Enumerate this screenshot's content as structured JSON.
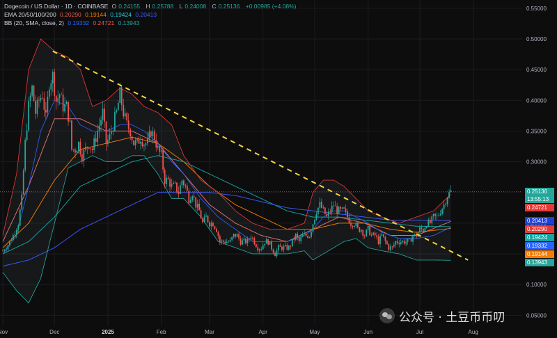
{
  "legend": {
    "line1": {
      "title": "Dogecoin / US Dollar · 1D · COINBASE",
      "o_label": "O",
      "o": "0.24155",
      "h_label": "H",
      "h": "0.25788",
      "l_label": "L",
      "l": "0.24008",
      "c_label": "C",
      "c": "0.25136",
      "change": "+0.00985 (+4.08%)"
    },
    "line2": {
      "name": "EMA 20/50/100/200",
      "v1": "0.20290",
      "v2": "0.19144",
      "v3": "0.19424",
      "v4": "0.20413"
    },
    "line3": {
      "name": "BB (20, SMA, close, 2)",
      "v1": "0.19332",
      "v2": "0.24721",
      "v3": "0.13943"
    }
  },
  "price_tags": [
    {
      "text": "0.25136",
      "sub": "13:55:13",
      "color": "#26a69a",
      "value": 0.25136
    },
    {
      "text": "0.24721",
      "color": "#e53935",
      "value": 0.24721
    },
    {
      "text": "0.20413",
      "color": "#1e3fd8",
      "value": 0.20413
    },
    {
      "text": "0.20290",
      "color": "#e53935",
      "value": 0.2029
    },
    {
      "text": "0.19424",
      "color": "#14a6a0",
      "value": 0.19424
    },
    {
      "text": "0.19332",
      "color": "#2962ff",
      "value": 0.19332
    },
    {
      "text": "0.19144",
      "color": "#f57c00",
      "value": 0.19144
    },
    {
      "text": "0.13943",
      "color": "#26a69a",
      "value": 0.13943
    }
  ],
  "watermark": {
    "text": "公众号 · 土豆币币叨"
  },
  "colors": {
    "up": "#26a69a",
    "down": "#ef5350",
    "ema20": "#e57373",
    "ema50": "#f57c00",
    "ema100": "#14a6a0",
    "ema200": "#3d5afe",
    "bb_basis": "#2962ff",
    "bb_band": "#e53935",
    "bb_lower": "#26a69a",
    "trendline": "#f5d63d"
  },
  "chart_data": {
    "type": "candlestick",
    "ylim": [
      0.03,
      0.56
    ],
    "y_ticks": [
      0.55,
      0.5,
      0.45,
      0.4,
      0.35,
      0.3,
      0.25,
      0.2,
      0.15,
      0.1,
      0.05
    ],
    "y_tick_labels": [
      "0.55000",
      "0.50000",
      "0.45000",
      "0.40000",
      "0.35000",
      "0.30000",
      "0.25000",
      "0.20000",
      "0.15000",
      "0.10000",
      "0.05000"
    ],
    "x_labels": [
      {
        "label": "Nov",
        "day": 0
      },
      {
        "label": "Dec",
        "day": 30
      },
      {
        "label": "2025",
        "day": 61,
        "bold": true
      },
      {
        "label": "Feb",
        "day": 92
      },
      {
        "label": "Mar",
        "day": 120
      },
      {
        "label": "Apr",
        "day": 151
      },
      {
        "label": "May",
        "day": 181
      },
      {
        "label": "Jun",
        "day": 212
      },
      {
        "label": "Jul",
        "day": 242
      },
      {
        "label": "Aug",
        "day": 273
      }
    ],
    "total_days": 261,
    "close_path": [
      [
        0,
        0.155
      ],
      [
        3,
        0.165
      ],
      [
        6,
        0.18
      ],
      [
        9,
        0.2
      ],
      [
        11,
        0.24
      ],
      [
        13,
        0.33
      ],
      [
        15,
        0.39
      ],
      [
        17,
        0.42
      ],
      [
        19,
        0.38
      ],
      [
        21,
        0.4
      ],
      [
        23,
        0.41
      ],
      [
        25,
        0.37
      ],
      [
        27,
        0.43
      ],
      [
        29,
        0.44
      ],
      [
        31,
        0.4
      ],
      [
        33,
        0.41
      ],
      [
        35,
        0.39
      ],
      [
        37,
        0.39
      ],
      [
        39,
        0.36
      ],
      [
        40,
        0.32
      ],
      [
        42,
        0.32
      ],
      [
        44,
        0.33
      ],
      [
        46,
        0.31
      ],
      [
        48,
        0.32
      ],
      [
        50,
        0.33
      ],
      [
        52,
        0.32
      ],
      [
        54,
        0.34
      ],
      [
        56,
        0.36
      ],
      [
        58,
        0.38
      ],
      [
        60,
        0.33
      ],
      [
        62,
        0.34
      ],
      [
        64,
        0.36
      ],
      [
        66,
        0.38
      ],
      [
        68,
        0.41
      ],
      [
        70,
        0.38
      ],
      [
        72,
        0.36
      ],
      [
        74,
        0.35
      ],
      [
        76,
        0.33
      ],
      [
        78,
        0.33
      ],
      [
        80,
        0.34
      ],
      [
        82,
        0.33
      ],
      [
        84,
        0.33
      ],
      [
        86,
        0.35
      ],
      [
        88,
        0.34
      ],
      [
        90,
        0.32
      ],
      [
        92,
        0.31
      ],
      [
        94,
        0.27
      ],
      [
        96,
        0.27
      ],
      [
        98,
        0.26
      ],
      [
        100,
        0.26
      ],
      [
        102,
        0.25
      ],
      [
        104,
        0.27
      ],
      [
        106,
        0.26
      ],
      [
        108,
        0.24
      ],
      [
        110,
        0.25
      ],
      [
        112,
        0.23
      ],
      [
        114,
        0.22
      ],
      [
        116,
        0.2
      ],
      [
        118,
        0.21
      ],
      [
        120,
        0.2
      ],
      [
        122,
        0.2
      ],
      [
        124,
        0.19
      ],
      [
        126,
        0.17
      ],
      [
        128,
        0.17
      ],
      [
        130,
        0.17
      ],
      [
        132,
        0.17
      ],
      [
        134,
        0.18
      ],
      [
        136,
        0.18
      ],
      [
        138,
        0.17
      ],
      [
        140,
        0.17
      ],
      [
        142,
        0.17
      ],
      [
        144,
        0.18
      ],
      [
        146,
        0.17
      ],
      [
        148,
        0.16
      ],
      [
        150,
        0.16
      ],
      [
        152,
        0.17
      ],
      [
        154,
        0.17
      ],
      [
        156,
        0.16
      ],
      [
        158,
        0.15
      ],
      [
        160,
        0.16
      ],
      [
        162,
        0.16
      ],
      [
        164,
        0.16
      ],
      [
        166,
        0.16
      ],
      [
        168,
        0.17
      ],
      [
        170,
        0.18
      ],
      [
        172,
        0.17
      ],
      [
        174,
        0.18
      ],
      [
        176,
        0.18
      ],
      [
        178,
        0.18
      ],
      [
        180,
        0.2
      ],
      [
        182,
        0.22
      ],
      [
        184,
        0.23
      ],
      [
        186,
        0.22
      ],
      [
        188,
        0.21
      ],
      [
        190,
        0.22
      ],
      [
        192,
        0.23
      ],
      [
        194,
        0.22
      ],
      [
        196,
        0.22
      ],
      [
        198,
        0.22
      ],
      [
        200,
        0.21
      ],
      [
        202,
        0.2
      ],
      [
        204,
        0.2
      ],
      [
        206,
        0.19
      ],
      [
        208,
        0.19
      ],
      [
        210,
        0.18
      ],
      [
        212,
        0.19
      ],
      [
        214,
        0.18
      ],
      [
        216,
        0.18
      ],
      [
        218,
        0.17
      ],
      [
        220,
        0.18
      ],
      [
        222,
        0.17
      ],
      [
        224,
        0.16
      ],
      [
        226,
        0.16
      ],
      [
        228,
        0.17
      ],
      [
        230,
        0.17
      ],
      [
        232,
        0.17
      ],
      [
        234,
        0.17
      ],
      [
        236,
        0.17
      ],
      [
        238,
        0.18
      ],
      [
        240,
        0.18
      ],
      [
        242,
        0.19
      ],
      [
        244,
        0.19
      ],
      [
        246,
        0.2
      ],
      [
        248,
        0.2
      ],
      [
        250,
        0.21
      ],
      [
        252,
        0.21
      ],
      [
        254,
        0.22
      ],
      [
        256,
        0.23
      ],
      [
        258,
        0.245
      ],
      [
        260,
        0.25136
      ]
    ],
    "series": [
      {
        "name": "EMA 20",
        "color": "#e57373",
        "points": [
          [
            0,
            0.17
          ],
          [
            15,
            0.26
          ],
          [
            30,
            0.37
          ],
          [
            45,
            0.37
          ],
          [
            60,
            0.35
          ],
          [
            75,
            0.35
          ],
          [
            90,
            0.33
          ],
          [
            105,
            0.28
          ],
          [
            120,
            0.23
          ],
          [
            135,
            0.2
          ],
          [
            150,
            0.18
          ],
          [
            165,
            0.17
          ],
          [
            180,
            0.19
          ],
          [
            195,
            0.21
          ],
          [
            210,
            0.2
          ],
          [
            225,
            0.18
          ],
          [
            240,
            0.18
          ],
          [
            260,
            0.2029
          ]
        ]
      },
      {
        "name": "EMA 50",
        "color": "#f57c00",
        "points": [
          [
            0,
            0.16
          ],
          [
            15,
            0.2
          ],
          [
            30,
            0.27
          ],
          [
            45,
            0.32
          ],
          [
            60,
            0.33
          ],
          [
            75,
            0.34
          ],
          [
            90,
            0.33
          ],
          [
            105,
            0.3
          ],
          [
            120,
            0.26
          ],
          [
            135,
            0.23
          ],
          [
            150,
            0.21
          ],
          [
            165,
            0.19
          ],
          [
            180,
            0.19
          ],
          [
            195,
            0.2
          ],
          [
            210,
            0.2
          ],
          [
            225,
            0.19
          ],
          [
            240,
            0.185
          ],
          [
            260,
            0.19144
          ]
        ]
      },
      {
        "name": "EMA 100",
        "color": "#14a6a0",
        "points": [
          [
            0,
            0.15
          ],
          [
            15,
            0.17
          ],
          [
            30,
            0.21
          ],
          [
            45,
            0.26
          ],
          [
            60,
            0.28
          ],
          [
            75,
            0.3
          ],
          [
            90,
            0.31
          ],
          [
            105,
            0.3
          ],
          [
            120,
            0.28
          ],
          [
            135,
            0.26
          ],
          [
            150,
            0.24
          ],
          [
            165,
            0.22
          ],
          [
            180,
            0.21
          ],
          [
            195,
            0.21
          ],
          [
            210,
            0.205
          ],
          [
            225,
            0.2
          ],
          [
            240,
            0.195
          ],
          [
            260,
            0.19424
          ]
        ]
      },
      {
        "name": "EMA 200",
        "color": "#3d5afe",
        "points": [
          [
            0,
            0.13
          ],
          [
            15,
            0.14
          ],
          [
            30,
            0.16
          ],
          [
            45,
            0.19
          ],
          [
            60,
            0.21
          ],
          [
            75,
            0.23
          ],
          [
            90,
            0.25
          ],
          [
            105,
            0.25
          ],
          [
            120,
            0.25
          ],
          [
            135,
            0.245
          ],
          [
            150,
            0.235
          ],
          [
            165,
            0.225
          ],
          [
            180,
            0.22
          ],
          [
            195,
            0.215
          ],
          [
            210,
            0.21
          ],
          [
            225,
            0.205
          ],
          [
            240,
            0.205
          ],
          [
            260,
            0.20413
          ]
        ]
      },
      {
        "name": "BB upper",
        "color": "#e53935",
        "points": [
          [
            0,
            0.18
          ],
          [
            8,
            0.28
          ],
          [
            15,
            0.45
          ],
          [
            22,
            0.5
          ],
          [
            30,
            0.48
          ],
          [
            38,
            0.47
          ],
          [
            45,
            0.45
          ],
          [
            52,
            0.39
          ],
          [
            60,
            0.4
          ],
          [
            68,
            0.42
          ],
          [
            75,
            0.41
          ],
          [
            82,
            0.39
          ],
          [
            90,
            0.38
          ],
          [
            98,
            0.36
          ],
          [
            105,
            0.31
          ],
          [
            115,
            0.27
          ],
          [
            125,
            0.25
          ],
          [
            135,
            0.22
          ],
          [
            145,
            0.2
          ],
          [
            155,
            0.19
          ],
          [
            165,
            0.19
          ],
          [
            175,
            0.2
          ],
          [
            180,
            0.25
          ],
          [
            186,
            0.27
          ],
          [
            192,
            0.27
          ],
          [
            198,
            0.26
          ],
          [
            205,
            0.24
          ],
          [
            212,
            0.22
          ],
          [
            220,
            0.21
          ],
          [
            230,
            0.2
          ],
          [
            240,
            0.21
          ],
          [
            250,
            0.22
          ],
          [
            260,
            0.24721
          ]
        ]
      },
      {
        "name": "BB basis",
        "color": "#2962ff",
        "points": [
          [
            0,
            0.15
          ],
          [
            8,
            0.18
          ],
          [
            15,
            0.26
          ],
          [
            22,
            0.35
          ],
          [
            30,
            0.4
          ],
          [
            38,
            0.39
          ],
          [
            45,
            0.36
          ],
          [
            52,
            0.35
          ],
          [
            60,
            0.35
          ],
          [
            68,
            0.36
          ],
          [
            75,
            0.36
          ],
          [
            82,
            0.35
          ],
          [
            90,
            0.33
          ],
          [
            98,
            0.3
          ],
          [
            105,
            0.28
          ],
          [
            115,
            0.24
          ],
          [
            125,
            0.21
          ],
          [
            135,
            0.19
          ],
          [
            145,
            0.17
          ],
          [
            155,
            0.17
          ],
          [
            165,
            0.17
          ],
          [
            175,
            0.18
          ],
          [
            180,
            0.19
          ],
          [
            186,
            0.21
          ],
          [
            192,
            0.22
          ],
          [
            198,
            0.22
          ],
          [
            205,
            0.21
          ],
          [
            212,
            0.2
          ],
          [
            220,
            0.185
          ],
          [
            230,
            0.175
          ],
          [
            240,
            0.175
          ],
          [
            250,
            0.18
          ],
          [
            260,
            0.19332
          ]
        ]
      },
      {
        "name": "BB lower",
        "color": "#26a69a",
        "points": [
          [
            0,
            0.12
          ],
          [
            8,
            0.09
          ],
          [
            15,
            0.07
          ],
          [
            22,
            0.11
          ],
          [
            30,
            0.2
          ],
          [
            38,
            0.29
          ],
          [
            45,
            0.3
          ],
          [
            52,
            0.31
          ],
          [
            60,
            0.3
          ],
          [
            68,
            0.3
          ],
          [
            75,
            0.31
          ],
          [
            82,
            0.31
          ],
          [
            90,
            0.28
          ],
          [
            98,
            0.24
          ],
          [
            105,
            0.24
          ],
          [
            115,
            0.21
          ],
          [
            125,
            0.17
          ],
          [
            135,
            0.16
          ],
          [
            145,
            0.15
          ],
          [
            155,
            0.15
          ],
          [
            165,
            0.15
          ],
          [
            175,
            0.155
          ],
          [
            180,
            0.14
          ],
          [
            186,
            0.15
          ],
          [
            192,
            0.16
          ],
          [
            198,
            0.17
          ],
          [
            205,
            0.175
          ],
          [
            212,
            0.16
          ],
          [
            220,
            0.155
          ],
          [
            230,
            0.15
          ],
          [
            240,
            0.14
          ],
          [
            250,
            0.14
          ],
          [
            260,
            0.13943
          ]
        ]
      }
    ],
    "trendline": [
      [
        29,
        0.48
      ],
      [
        270,
        0.14
      ]
    ]
  }
}
